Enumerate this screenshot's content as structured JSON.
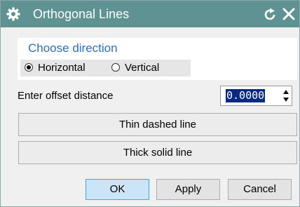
{
  "window": {
    "title": "Orthogonal Lines",
    "icons": {
      "left": "gear-icon",
      "reset": "reset-icon",
      "close": "close-icon"
    },
    "title_bar_color": "#5f9292"
  },
  "direction_group": {
    "title": "Choose direction",
    "options": [
      {
        "label": "Horizontal",
        "selected": true
      },
      {
        "label": "Vertical",
        "selected": false
      }
    ],
    "title_color": "#2e6fb8"
  },
  "offset": {
    "label": "Enter offset distance",
    "value": "0.0000"
  },
  "line_buttons": {
    "thin_dashed": "Thin dashed line",
    "thick_solid": "Thick solid line"
  },
  "footer": {
    "ok": "OK",
    "apply": "Apply",
    "cancel": "Cancel"
  }
}
